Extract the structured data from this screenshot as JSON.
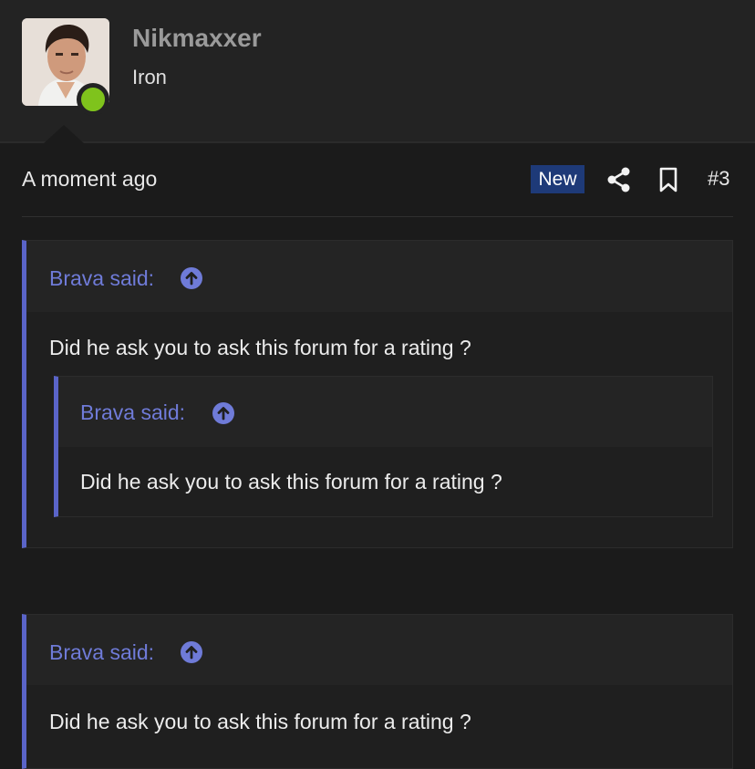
{
  "user": {
    "name": "Nikmaxxer",
    "rank": "Iron",
    "online": true
  },
  "post": {
    "timestamp": "A moment ago",
    "badge": "New",
    "number": "#3"
  },
  "quotes": [
    {
      "author": "Brava said:",
      "text": "Did he ask you to ask this forum for a rating ?",
      "nested": {
        "author": "Brava said:",
        "text": "Did he ask you to ask this forum for a rating ?"
      }
    },
    {
      "author": "Brava said:",
      "text": "Did he ask you to ask this forum for a rating ?"
    }
  ],
  "colors": {
    "accent": "#5a64c8",
    "quote_author": "#6f7bd8",
    "online": "#7fc31c",
    "badge": "#1e3a78"
  },
  "icons": {
    "share": "share-icon",
    "bookmark": "bookmark-icon",
    "jump": "arrow-up-circle-icon"
  }
}
